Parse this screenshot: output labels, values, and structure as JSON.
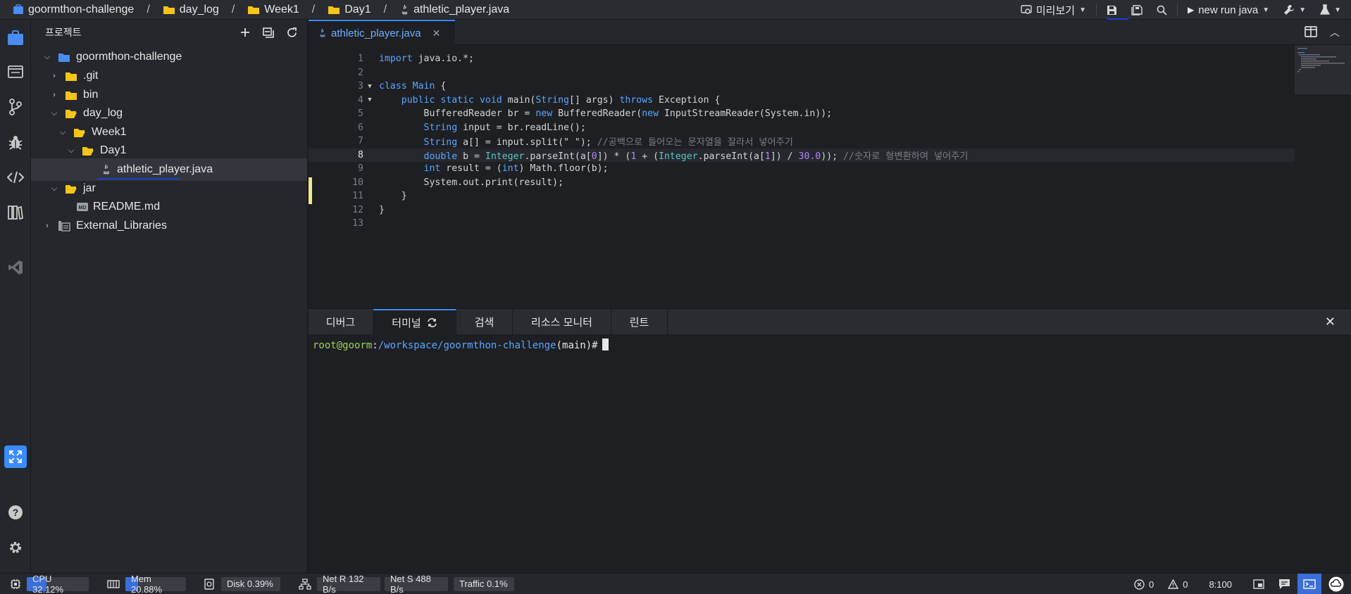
{
  "breadcrumb": {
    "items": [
      "goormthon-challenge",
      "day_log",
      "Week1",
      "Day1",
      "athletic_player.java"
    ],
    "separator": "/"
  },
  "toolbar": {
    "preview_label": "미리보기",
    "run_label": "new run java"
  },
  "sidebar": {
    "title": "프로젝트",
    "tree": [
      {
        "label": "goormthon-challenge",
        "kind": "project",
        "expanded": true
      },
      {
        "label": ".git",
        "kind": "folder",
        "expanded": false
      },
      {
        "label": "bin",
        "kind": "folder",
        "expanded": false
      },
      {
        "label": "day_log",
        "kind": "folder",
        "expanded": true
      },
      {
        "label": "Week1",
        "kind": "folder",
        "expanded": true
      },
      {
        "label": "Day1",
        "kind": "folder",
        "expanded": true
      },
      {
        "label": "athletic_player.java",
        "kind": "java-file",
        "selected": true
      },
      {
        "label": "jar",
        "kind": "folder",
        "expanded": true
      },
      {
        "label": "README.md",
        "kind": "md-file"
      },
      {
        "label": "External_Libraries",
        "kind": "library",
        "expanded": false
      }
    ]
  },
  "editor": {
    "tab_label": "athletic_player.java",
    "current_line": 8,
    "line_numbers": [
      "1",
      "2",
      "3",
      "4",
      "5",
      "6",
      "7",
      "8",
      "9",
      "10",
      "11",
      "12",
      "13"
    ]
  },
  "panel": {
    "tabs": [
      "디버그",
      "터미널",
      "검색",
      "리소스 모니터",
      "린트"
    ],
    "active_tab": "터미널",
    "prompt_user": "root@goorm",
    "prompt_sep": ":",
    "prompt_path": "/workspace/goormthon-challenge",
    "prompt_branch": "(main)#"
  },
  "status": {
    "cpu_label": "CPU 32.12%",
    "cpu_fraction": 0.3212,
    "mem_label": "Mem 20.88%",
    "mem_fraction": 0.2088,
    "disk_label": "Disk 0.39%",
    "net_r_label": "Net R 132 B/s",
    "net_s_label": "Net S 488 B/s",
    "traffic_label": "Traffic 0.1%",
    "errors": "0",
    "warnings": "0",
    "cursor_pos": "8:100"
  },
  "colors": {
    "accent": "#3b8cff",
    "keyword": "#5aa6ff",
    "comment": "#7a7d84",
    "number": "#b585ff",
    "terminal_user": "#9bd35a",
    "folder": "#f5c518"
  }
}
